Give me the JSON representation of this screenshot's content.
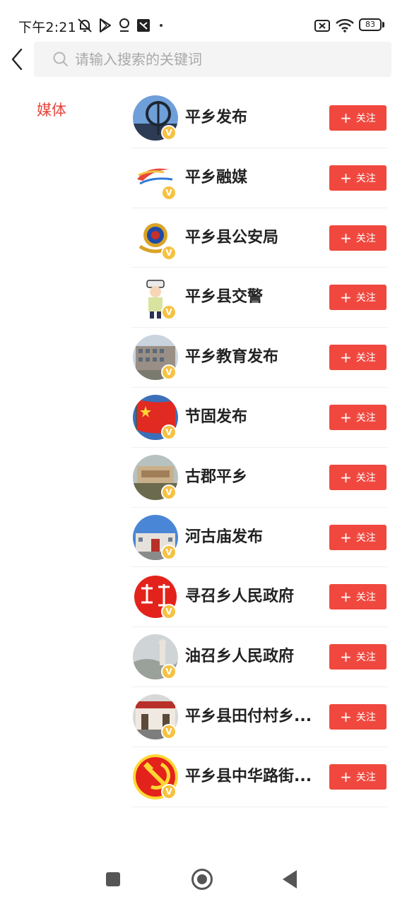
{
  "status_bar": {
    "time": "下午2:21",
    "battery": "83",
    "icons": [
      "mute-bell-icon",
      "play-store-icon",
      "location-icon",
      "app-icon",
      "sim-off-icon",
      "wifi-icon",
      "battery-icon"
    ]
  },
  "header": {
    "search_placeholder": "请输入搜索的关键词"
  },
  "sidebar": {
    "category": "媒体"
  },
  "follow_label": "关注",
  "verified_label": "V",
  "accounts": [
    {
      "name": "平乡发布"
    },
    {
      "name": "平乡融媒"
    },
    {
      "name": "平乡县公安局"
    },
    {
      "name": "平乡县交警"
    },
    {
      "name": "平乡教育发布"
    },
    {
      "name": "节固发布"
    },
    {
      "name": "古郡平乡"
    },
    {
      "name": "河古庙发布"
    },
    {
      "name": "寻召乡人民政府"
    },
    {
      "name": "油召乡人民政府"
    },
    {
      "name": "平乡县田付村乡..."
    },
    {
      "name": "平乡县中华路街..."
    }
  ],
  "colors": {
    "accent": "#f0483f",
    "category_text": "#e8453c",
    "verified": "#f5c242"
  }
}
